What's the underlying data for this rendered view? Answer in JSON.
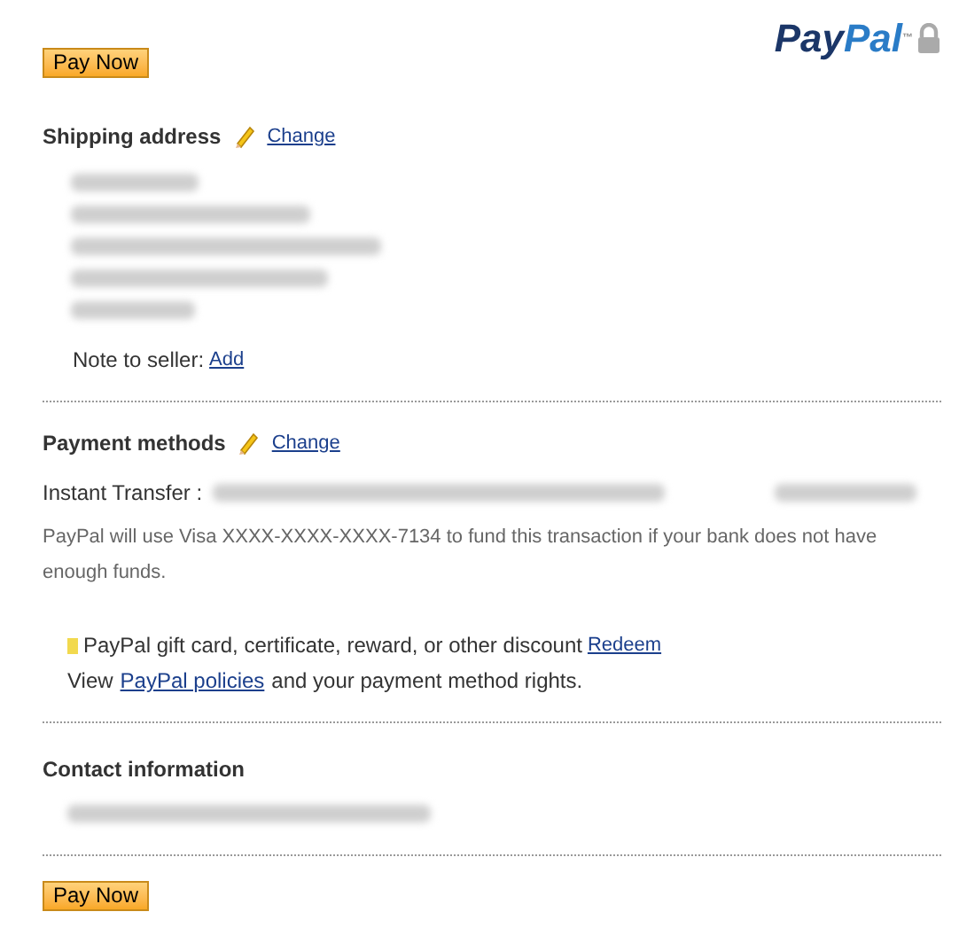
{
  "top_button": "Pay Now",
  "logo": {
    "parts": [
      "Pay",
      "Pal"
    ],
    "tm": "™"
  },
  "shipping": {
    "title": "Shipping address",
    "change": "Change",
    "note_label": "Note to seller:",
    "note_link": "Add"
  },
  "payment": {
    "title": "Payment methods",
    "change": "Change",
    "transfer_label": "Instant Transfer :",
    "backup_note": "PayPal will use Visa XXXX-XXXX-XXXX-7134 to fund this transaction if your bank does not have enough funds.",
    "gift_text": "PayPal gift card, certificate, reward, or other discount",
    "gift_link": "Redeem",
    "policy_before": "View",
    "policy_link": "PayPal policies",
    "policy_after": "and your payment method rights."
  },
  "contact": {
    "title": "Contact information"
  },
  "bottom_button": "Pay Now"
}
